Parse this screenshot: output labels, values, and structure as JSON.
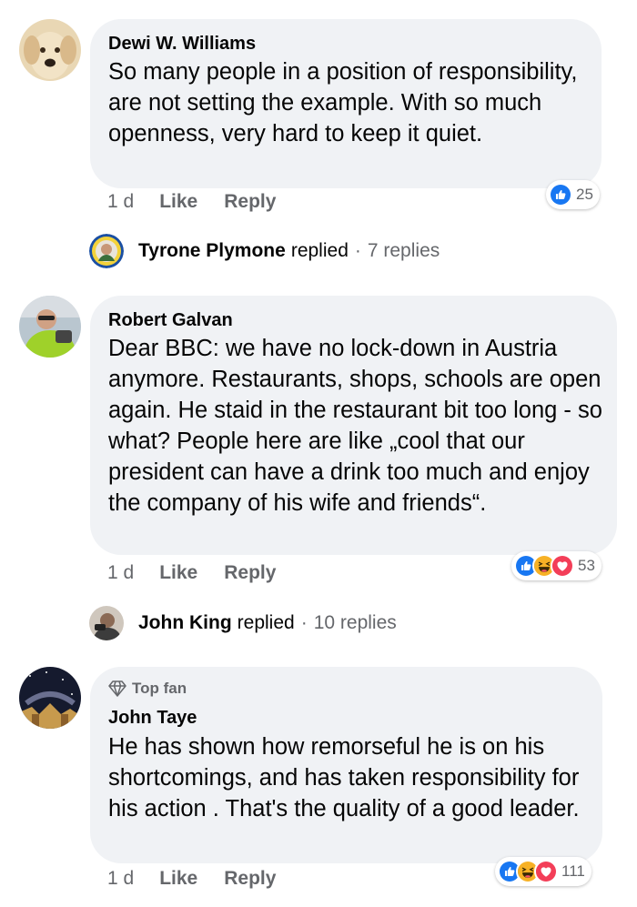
{
  "comments": [
    {
      "author": "Dewi W. Williams",
      "text": "So many people in a position of responsibility, are not setting the example. With so much openness, very hard to keep it quiet.",
      "time": "1 d",
      "like_label": "Like",
      "reply_label": "Reply",
      "reaction_count": "25",
      "reactions": [
        "like-icon"
      ],
      "reply_thread": {
        "name": "Tyrone Plymone",
        "verb": "replied",
        "separator": "·",
        "count": "7 replies"
      }
    },
    {
      "author": "Robert Galvan",
      "text": "Dear BBC: we have no lock-down in Austria anymore. Restaurants, shops, schools are open again. He staid in the restaurant bit too long - so what? People here are like „cool that our president can have a drink too much and enjoy the company of his wife and friends“.",
      "time": "1 d",
      "like_label": "Like",
      "reply_label": "Reply",
      "reaction_count": "53",
      "reactions": [
        "like-icon",
        "haha-icon",
        "love-icon"
      ],
      "reply_thread": {
        "name": "John King",
        "verb": "replied",
        "separator": "·",
        "count": "10 replies"
      }
    },
    {
      "badge": "Top fan",
      "author": "John Taye",
      "text": "He has shown how remorseful he is on his shortcomings, and has taken responsibility for his action . That's the quality of a good leader.",
      "time": "1 d",
      "like_label": "Like",
      "reply_label": "Reply",
      "reaction_count": "111",
      "reactions": [
        "like-icon",
        "haha-icon",
        "love-icon"
      ]
    }
  ],
  "colors": {
    "bubble": "#f0f2f5",
    "meta": "#65676b",
    "like_blue": "#1877f2",
    "love_red": "#f33e58",
    "haha_yellow": "#f7b125"
  }
}
